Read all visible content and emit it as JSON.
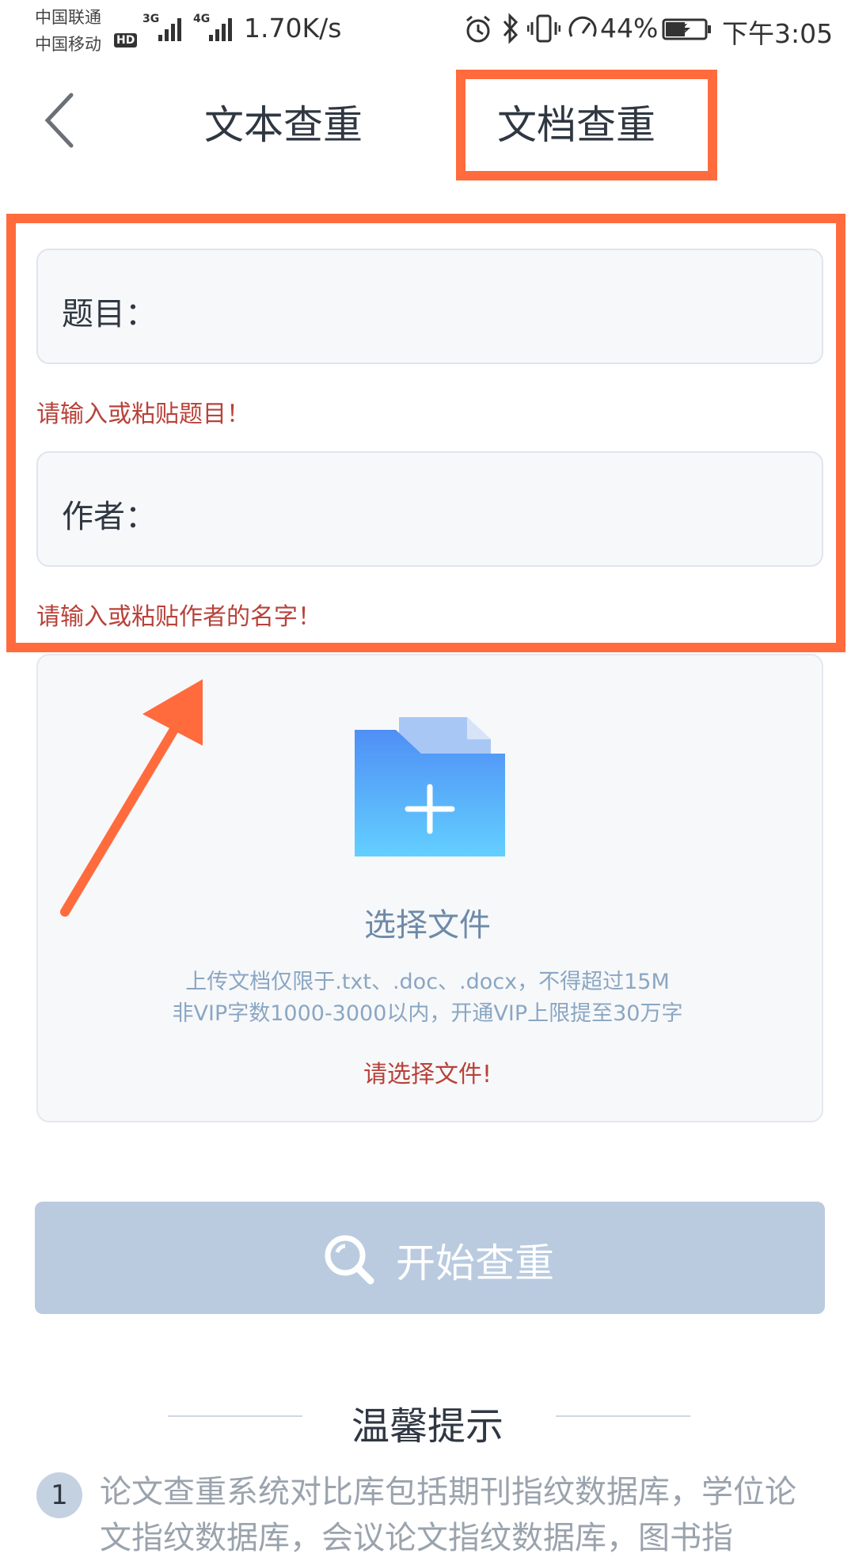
{
  "status_bar": {
    "carrier_1": "中国联通",
    "carrier_2": "中国移动",
    "hd_badge": "HD",
    "net_3g": "3G",
    "net_4g": "4G",
    "speed": "1.70K/s",
    "battery": "44%",
    "time": "下午3:05"
  },
  "header": {
    "tabs": [
      {
        "label": "文本查重",
        "active": false
      },
      {
        "label": "文档查重",
        "active": true
      }
    ]
  },
  "form": {
    "title_label": "题目：",
    "title_hint": "请输入或粘贴题目！",
    "author_label": "作者：",
    "author_hint": "请输入或粘贴作者的名字！"
  },
  "upload": {
    "choose_label": "选择文件",
    "desc_line1": "上传文档仅限于.txt、.doc、.docx，不得超过15M",
    "desc_line2": "非VIP字数1000-3000以内，开通VIP上限提至30万字",
    "error": "请选择文件!"
  },
  "start_button": {
    "label": "开始查重"
  },
  "tips": {
    "title": "温馨提示",
    "items": [
      {
        "num": "1",
        "text": "论文查重系统对比库包括期刊指纹数据库，学位论文指纹数据库，会议论文指纹数据库，图书指"
      }
    ]
  },
  "colors": {
    "annotation": "#ff6b3d",
    "hint_red": "#b8423a",
    "button_disabled": "#bacbe0",
    "folder_blue": "#5aa2f7"
  }
}
